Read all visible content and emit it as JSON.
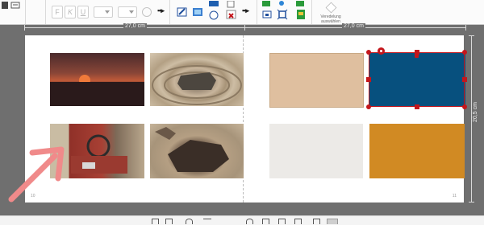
{
  "toolbar": {
    "format_buttons": [
      "F",
      "K",
      "U"
    ],
    "refinement_label": "Veredelung auswählen"
  },
  "ruler": {
    "left_width": "27,0 cm",
    "right_width": "27,0 cm",
    "height": "20,5 cm"
  },
  "spread": {
    "left_page_number": "10",
    "right_page_number": "11",
    "photos": [
      "sunset-photo",
      "stone-amphitheater-photo",
      "rusty-car-photo",
      "rock-photo"
    ]
  },
  "swatches": {
    "colors": [
      "#dfbf9f",
      "#07507e",
      "#eceae7",
      "#d18a23"
    ],
    "selected_color": "#07507e"
  },
  "colors": {
    "selection": "#c4161c",
    "canvas_background": "#6f6f6f",
    "annotation_arrow": "#f08080"
  }
}
